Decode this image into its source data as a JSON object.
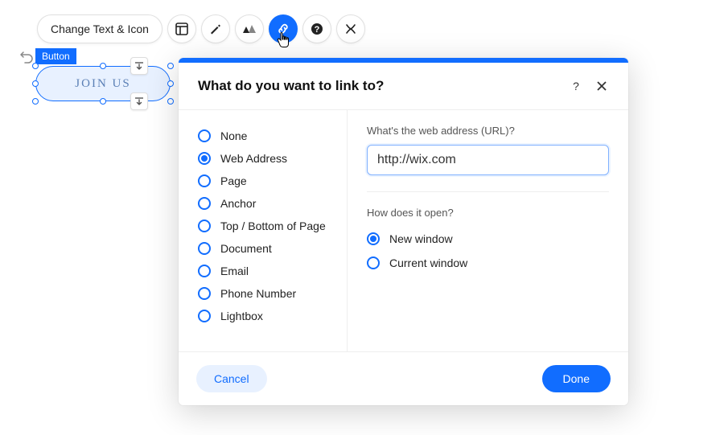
{
  "toolbar": {
    "change_label": "Change Text & Icon",
    "icons": [
      "layout-icon",
      "brush-icon",
      "animation-icon",
      "link-icon",
      "help-icon",
      "stretch-icon"
    ],
    "active_index": 3
  },
  "selection": {
    "badge": "Button",
    "button_text": "JOIN US"
  },
  "dialog": {
    "title": "What do you want to link to?",
    "link_types": [
      "None",
      "Web Address",
      "Page",
      "Anchor",
      "Top / Bottom of Page",
      "Document",
      "Email",
      "Phone Number",
      "Lightbox"
    ],
    "link_type_selected": 1,
    "url_label": "What's the web address (URL)?",
    "url_value": "http://wix.com",
    "open_label": "How does it open?",
    "open_options": [
      "New window",
      "Current window"
    ],
    "open_selected": 0,
    "cancel": "Cancel",
    "done": "Done"
  }
}
